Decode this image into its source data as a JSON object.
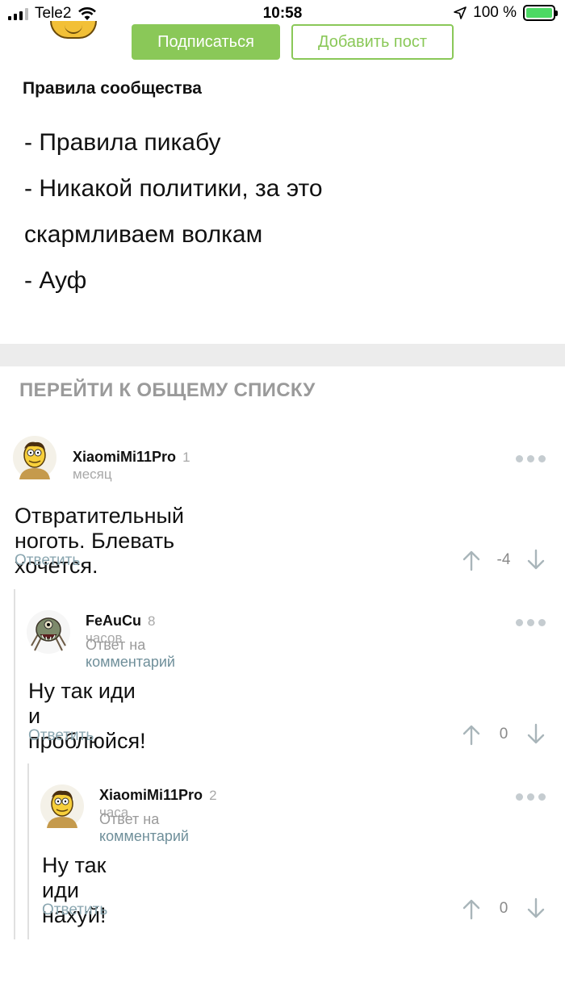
{
  "status_bar": {
    "carrier": "Tele2",
    "time": "10:58",
    "battery": "100 %"
  },
  "community": {
    "subscribe_label": "Подписаться",
    "add_post_label": "Добавить пост",
    "rules_title": "Правила сообщества",
    "rules": [
      "- Правила пикабу",
      "- Никакой политики, за это",
      "скармливаем волкам",
      "- Ауф"
    ]
  },
  "goto_list": "ПЕРЕЙТИ К ОБЩЕМУ СПИСКУ",
  "comments": [
    {
      "author": "XiaomiMi11Pro",
      "time": "1 месяц",
      "text": "Отвратительный ноготь. Блевать хочется.",
      "reply_label": "Ответить",
      "score": "-4"
    },
    {
      "author": "FeAuCu",
      "time": "8 часов",
      "reply_prefix": "Ответ на",
      "reply_link": "комментарий",
      "text": "Ну так иди и проблюйся!",
      "reply_label": "Ответить",
      "score": "0"
    },
    {
      "author": "XiaomiMi11Pro",
      "time": "2 часа",
      "reply_prefix": "Ответ на",
      "reply_link": "комментарий",
      "text": "Ну так иди нахуй!",
      "reply_label": "Ответить",
      "score": "0"
    }
  ]
}
